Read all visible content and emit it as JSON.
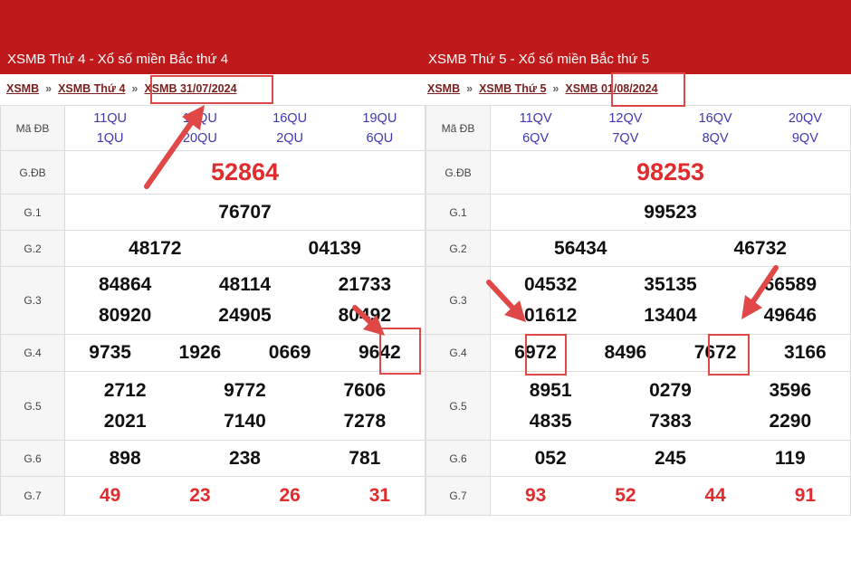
{
  "left": {
    "header_title": "XSMB Thứ 4 - Xổ số miền Bắc thứ 4",
    "breadcrumb": [
      "XSMB",
      "XSMB Thứ 4",
      "XSMB 31/07/2024"
    ],
    "breadcrumb_sep": "»",
    "labels": [
      "Mã ĐB",
      "G.ĐB",
      "G.1",
      "G.2",
      "G.3",
      "G.4",
      "G.5",
      "G.6",
      "G.7"
    ],
    "ma_db": [
      "11QU",
      "15QU",
      "16QU",
      "19QU",
      "1QU",
      "20QU",
      "2QU",
      "6QU"
    ],
    "gdb": "52864",
    "g1": [
      "76707"
    ],
    "g2": [
      "48172",
      "04139"
    ],
    "g3": [
      "84864",
      "48114",
      "21733",
      "80920",
      "24905",
      "80492"
    ],
    "g4": [
      "9735",
      "1926",
      "0669",
      "9642"
    ],
    "g5": [
      "2712",
      "9772",
      "7606",
      "2021",
      "7140",
      "7278"
    ],
    "g6": [
      "898",
      "238",
      "781"
    ],
    "g7": [
      "49",
      "23",
      "26",
      "31"
    ]
  },
  "right": {
    "header_title": "XSMB Thứ 5 - Xổ số miền Bắc thứ 5",
    "breadcrumb": [
      "XSMB",
      "XSMB Thứ 5",
      "XSMB 01/08/2024"
    ],
    "breadcrumb_sep": "»",
    "labels": [
      "Mã ĐB",
      "G.ĐB",
      "G.1",
      "G.2",
      "G.3",
      "G.4",
      "G.5",
      "G.6",
      "G.7"
    ],
    "ma_db": [
      "11QV",
      "12QV",
      "16QV",
      "20QV",
      "6QV",
      "7QV",
      "8QV",
      "9QV"
    ],
    "gdb": "98253",
    "g1": [
      "99523"
    ],
    "g2": [
      "56434",
      "46732"
    ],
    "g3": [
      "04532",
      "35135",
      "66589",
      "01612",
      "13404",
      "49646"
    ],
    "g4": [
      "6972",
      "8496",
      "7672",
      "3166"
    ],
    "g5": [
      "8951",
      "0279",
      "3596",
      "4835",
      "7383",
      "2290"
    ],
    "g6": [
      "052",
      "245",
      "119"
    ],
    "g7": [
      "93",
      "52",
      "44",
      "91"
    ]
  },
  "colors": {
    "header_bg": "#c0191b",
    "prize_red": "#e02c2c",
    "code_blue": "#3d38b3",
    "highlight_box": "#e04848",
    "arrow": "#e04848"
  }
}
